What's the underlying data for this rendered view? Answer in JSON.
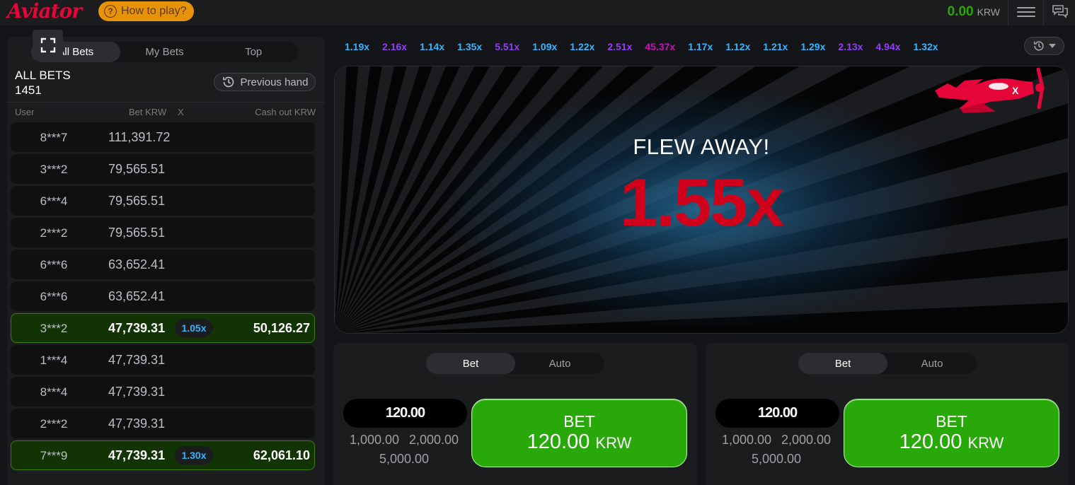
{
  "header": {
    "logo": "Aviator",
    "how_to_play": "How to play?",
    "balance": "0.00",
    "currency": "KRW"
  },
  "left_panel": {
    "tabs": [
      "All Bets",
      "My Bets",
      "Top"
    ],
    "title": "ALL BETS",
    "count": "1451",
    "previous_hand": "Previous hand",
    "columns": {
      "user": "User",
      "bet": "Bet KRW",
      "x": "X",
      "cashout": "Cash out KRW"
    },
    "rows": [
      {
        "user": "8***7",
        "bet": "111,391.72",
        "mult": "",
        "cashout": ""
      },
      {
        "user": "3***2",
        "bet": "79,565.51",
        "mult": "",
        "cashout": ""
      },
      {
        "user": "6***4",
        "bet": "79,565.51",
        "mult": "",
        "cashout": ""
      },
      {
        "user": "2***2",
        "bet": "79,565.51",
        "mult": "",
        "cashout": ""
      },
      {
        "user": "6***6",
        "bet": "63,652.41",
        "mult": "",
        "cashout": ""
      },
      {
        "user": "6***6",
        "bet": "63,652.41",
        "mult": "",
        "cashout": ""
      },
      {
        "user": "3***2",
        "bet": "47,739.31",
        "mult": "1.05x",
        "cashout": "50,126.27"
      },
      {
        "user": "1***4",
        "bet": "47,739.31",
        "mult": "",
        "cashout": ""
      },
      {
        "user": "8***4",
        "bet": "47,739.31",
        "mult": "",
        "cashout": ""
      },
      {
        "user": "2***2",
        "bet": "47,739.31",
        "mult": "",
        "cashout": ""
      },
      {
        "user": "7***9",
        "bet": "47,739.31",
        "mult": "1.30x",
        "cashout": "62,061.10"
      }
    ]
  },
  "payouts": [
    {
      "v": "1.19x",
      "c": "blue"
    },
    {
      "v": "2.16x",
      "c": "purple"
    },
    {
      "v": "1.14x",
      "c": "blue"
    },
    {
      "v": "1.35x",
      "c": "blue"
    },
    {
      "v": "5.51x",
      "c": "purple"
    },
    {
      "v": "1.09x",
      "c": "blue"
    },
    {
      "v": "1.22x",
      "c": "blue"
    },
    {
      "v": "2.51x",
      "c": "purple"
    },
    {
      "v": "45.37x",
      "c": "pink"
    },
    {
      "v": "1.17x",
      "c": "blue"
    },
    {
      "v": "1.12x",
      "c": "blue"
    },
    {
      "v": "1.21x",
      "c": "blue"
    },
    {
      "v": "1.29x",
      "c": "blue"
    },
    {
      "v": "2.13x",
      "c": "purple"
    },
    {
      "v": "4.94x",
      "c": "purple"
    },
    {
      "v": "1.32x",
      "c": "blue"
    }
  ],
  "stage": {
    "status": "FLEW AWAY!",
    "multiplier": "1.55x"
  },
  "bet_panels": [
    {
      "tabs": [
        "Bet",
        "Auto"
      ],
      "amount": "120.00",
      "quick": [
        "1,000.00",
        "2,000.00",
        "5,000.00"
      ],
      "button_label": "BET",
      "button_amount": "120.00",
      "button_currency": "KRW"
    },
    {
      "tabs": [
        "Bet",
        "Auto"
      ],
      "amount": "120.00",
      "quick": [
        "1,000.00",
        "2,000.00",
        "5,000.00"
      ],
      "button_label": "BET",
      "button_amount": "120.00",
      "button_currency": "KRW"
    }
  ],
  "colors": {
    "accent_red": "#e50539",
    "green": "#28a909",
    "blue_mult": "#34b4ff",
    "purple_mult": "#913ef8",
    "pink_mult": "#c017b4"
  },
  "icons": [
    "question-icon",
    "menu-icon",
    "chat-icon",
    "fullscreen-icon",
    "history-icon",
    "history-dropdown-icon",
    "plane-icon"
  ]
}
